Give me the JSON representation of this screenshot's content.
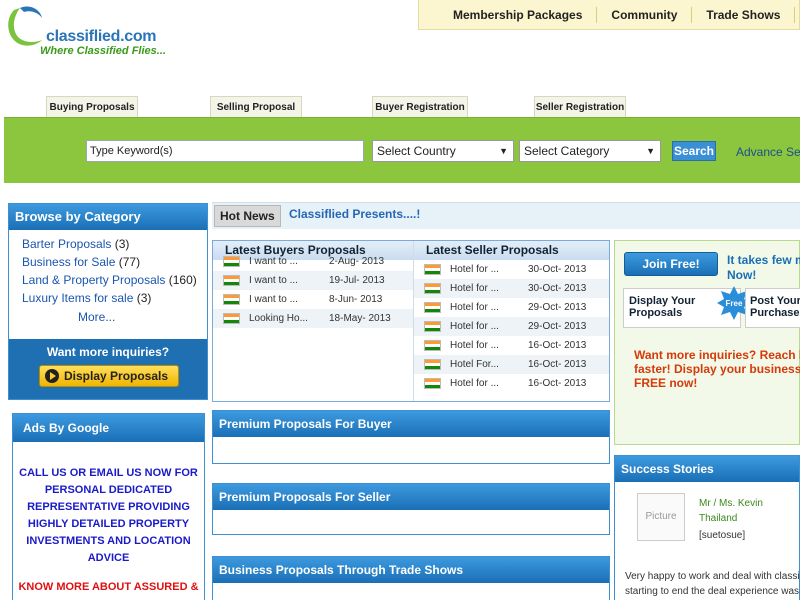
{
  "logo": {
    "name": "classiflied.com",
    "tagline": "Where Classified Flies..."
  },
  "topnav": [
    "Membership Packages",
    "Community",
    "Trade Shows",
    "Ad"
  ],
  "tabs": [
    "Buying Proposals",
    "Selling Proposal",
    "Buyer Registration",
    "Seller Registration"
  ],
  "search": {
    "keyword_value": "Type Keyword(s)",
    "country": "Select Country",
    "category": "Select Category",
    "button": "Search",
    "advance": "Advance Sea"
  },
  "browse": {
    "title": "Browse by Category",
    "items": [
      {
        "label": "Barter Proposals",
        "count": "(3)"
      },
      {
        "label": "Business for Sale",
        "count": "(77)"
      },
      {
        "label": "Land & Property Proposals",
        "count": "(160)"
      },
      {
        "label": "Luxury Items for sale",
        "count": "(3)"
      }
    ],
    "more": "More...",
    "inquiries": "Want more inquiries?",
    "display_button": "Display Proposals"
  },
  "ads": {
    "title": "Ads By Google",
    "text1": [
      "CALL US OR EMAIL US NOW FOR",
      "PERSONAL DEDICATED",
      "REPRESENTATIVE PROVIDING",
      "HIGHLY DETAILED PROPERTY",
      "INVESTMENTS AND LOCATION",
      "ADVICE"
    ],
    "text2": [
      "KNOW MORE ABOUT ASSURED &"
    ]
  },
  "hotnews": {
    "label": "Hot News",
    "text": "Classiflied Presents....!"
  },
  "buyers": {
    "title": "Latest Buyers Proposals",
    "rows": [
      {
        "title": "I want to ...",
        "date": "2-Aug- 2013"
      },
      {
        "title": "I want to ...",
        "date": "19-Jul- 2013"
      },
      {
        "title": "I want to ...",
        "date": "8-Jun- 2013"
      },
      {
        "title": "Looking Ho...",
        "date": "18-May- 2013"
      }
    ]
  },
  "sellers": {
    "title": "Latest Seller Proposals",
    "rows": [
      {
        "title": "Hotel for ...",
        "date": "30-Oct- 2013"
      },
      {
        "title": "Hotel for ...",
        "date": "30-Oct- 2013"
      },
      {
        "title": "Hotel for ...",
        "date": "29-Oct- 2013"
      },
      {
        "title": "Hotel for ...",
        "date": "29-Oct- 2013"
      },
      {
        "title": "Hotel for ...",
        "date": "16-Oct- 2013"
      },
      {
        "title": "Hotel For...",
        "date": "16-Oct- 2013"
      },
      {
        "title": "Hotel for ...",
        "date": "16-Oct- 2013"
      }
    ]
  },
  "premium_buyer": "Premium Proposals For Buyer",
  "premium_seller": "Premium Proposals For Seller",
  "trade_shows": "Business Proposals Through Trade Shows",
  "join": {
    "button": "Join Free!",
    "tagline": [
      "It takes few mi",
      "Now!"
    ],
    "display_card": [
      "Display Your",
      "Proposals"
    ],
    "free_badge": "Free",
    "post_card": [
      "Post Your",
      "Purchase"
    ],
    "message": [
      "Want more inquiries? Reach b",
      "faster! Display your business p",
      "FREE now!"
    ]
  },
  "success": {
    "title": "Success Stories",
    "picture": "Picture",
    "name": "Mr / Ms. Kevin",
    "location": "Thailand",
    "id": "[suetosue]",
    "text": [
      "Very happy to work and deal with classifli",
      "starting to end the deal experience was v"
    ]
  }
}
